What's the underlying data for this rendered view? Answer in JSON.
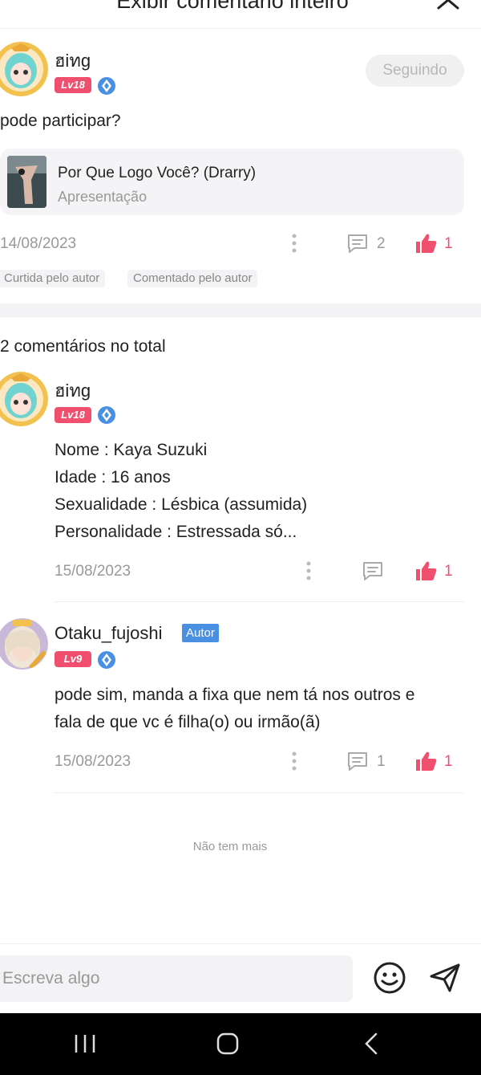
{
  "header": {
    "title": "Exibir comentário inteiro"
  },
  "post": {
    "username": "ฮiทg",
    "level": "Lv18",
    "follow_label": "Seguindo",
    "text": "pode participar?",
    "link_card": {
      "title": "Por Que Logo Você? (Drarry)",
      "subtitle": "Apresentação"
    },
    "date": "14/08/2023",
    "comment_count": "2",
    "like_count": "1",
    "tags": [
      "Curtida pelo autor",
      "Comentado pelo autor"
    ]
  },
  "comments_section": {
    "title": "2 comentários no total"
  },
  "comments": [
    {
      "username": "ฮiทg",
      "level": "Lv18",
      "lines": [
        "Nome : Kaya Suzuki",
        "Idade : 16 anos",
        "Sexualidade : Lésbica (assumida)",
        "Personalidade : Estressada só..."
      ],
      "date": "15/08/2023",
      "like_count": "1"
    },
    {
      "username": "Otaku_fujoshi",
      "author_badge": "Autor",
      "level": "Lv9",
      "lines": [
        "pode sim, manda a fixa que nem tá nos outros e",
        "fala de que vc é filha(o) ou irmão(ã)"
      ],
      "date": "15/08/2023",
      "comment_count": "1",
      "like_count": "1"
    }
  ],
  "footer": {
    "end_text": "Não tem mais"
  },
  "input": {
    "placeholder": "Escreva algo"
  },
  "colors": {
    "accent": "#f0506e",
    "author_badge": "#4a90e2",
    "muted": "#999999"
  },
  "icons": [
    "close-icon",
    "shield-icon",
    "more-icon",
    "comment-icon",
    "thumbs-up-icon",
    "emoji-icon",
    "send-icon",
    "recent-apps-icon",
    "home-icon",
    "back-icon"
  ]
}
